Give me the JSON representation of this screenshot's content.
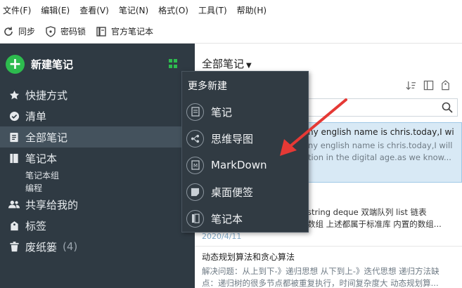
{
  "menubar": [
    "文件(F)",
    "编辑(E)",
    "查看(V)",
    "笔记(N)",
    "格式(O)",
    "工具(T)",
    "帮助(H)"
  ],
  "toolbar": {
    "sync": "同步",
    "lock": "密码锁",
    "official": "官方笔记本"
  },
  "sidebar": {
    "new_note": "新建笔记",
    "items": [
      {
        "label": "快捷方式",
        "icon": "star-icon"
      },
      {
        "label": "清单",
        "icon": "check-circle-icon"
      },
      {
        "label": "全部笔记",
        "icon": "notes-icon"
      },
      {
        "label": "笔记本",
        "icon": "notebook-icon"
      }
    ],
    "sub_items": [
      "笔记本组",
      "编程"
    ],
    "items2": [
      {
        "label": "共享给我的",
        "icon": "users-icon"
      },
      {
        "label": "标签",
        "icon": "tag-icon"
      },
      {
        "label": "废纸篓",
        "icon": "trash-icon",
        "count": "(4)"
      }
    ]
  },
  "main": {
    "title": "全部笔记",
    "cards": [
      {
        "title": "ny english name is chris.today,I wi...",
        "body1": "ny english name is chris.today,I will",
        "body2": "tion in the digital age.as we know..."
      },
      {
        "body1": "string deque 双端队列 list 链表",
        "body2": "数组 上述都属于标准库 内置的数组...",
        "date": "2020/4/11"
      },
      {
        "title": "动态规划算法和贪心算法",
        "body1": "解决问题：从上到下-》递归思想 从下到上-》迭代思想 递归方法缺",
        "body2": "点：递归树的很多节点都被重复执行，时间复杂度大 动态规划算..."
      }
    ]
  },
  "popup": {
    "title": "更多新建",
    "items": [
      {
        "label": "笔记",
        "icon": "note-icon"
      },
      {
        "label": "思维导图",
        "icon": "mindmap-icon"
      },
      {
        "label": "MarkDown",
        "icon": "markdown-icon"
      },
      {
        "label": "桌面便签",
        "icon": "sticky-note-icon"
      },
      {
        "label": "笔记本",
        "icon": "notebook-icon"
      }
    ]
  },
  "colors": {
    "accent": "#2dbb4e",
    "sidebar_bg": "#2f3a43",
    "popup_bg": "#313b43",
    "arrow": "#e53935"
  }
}
